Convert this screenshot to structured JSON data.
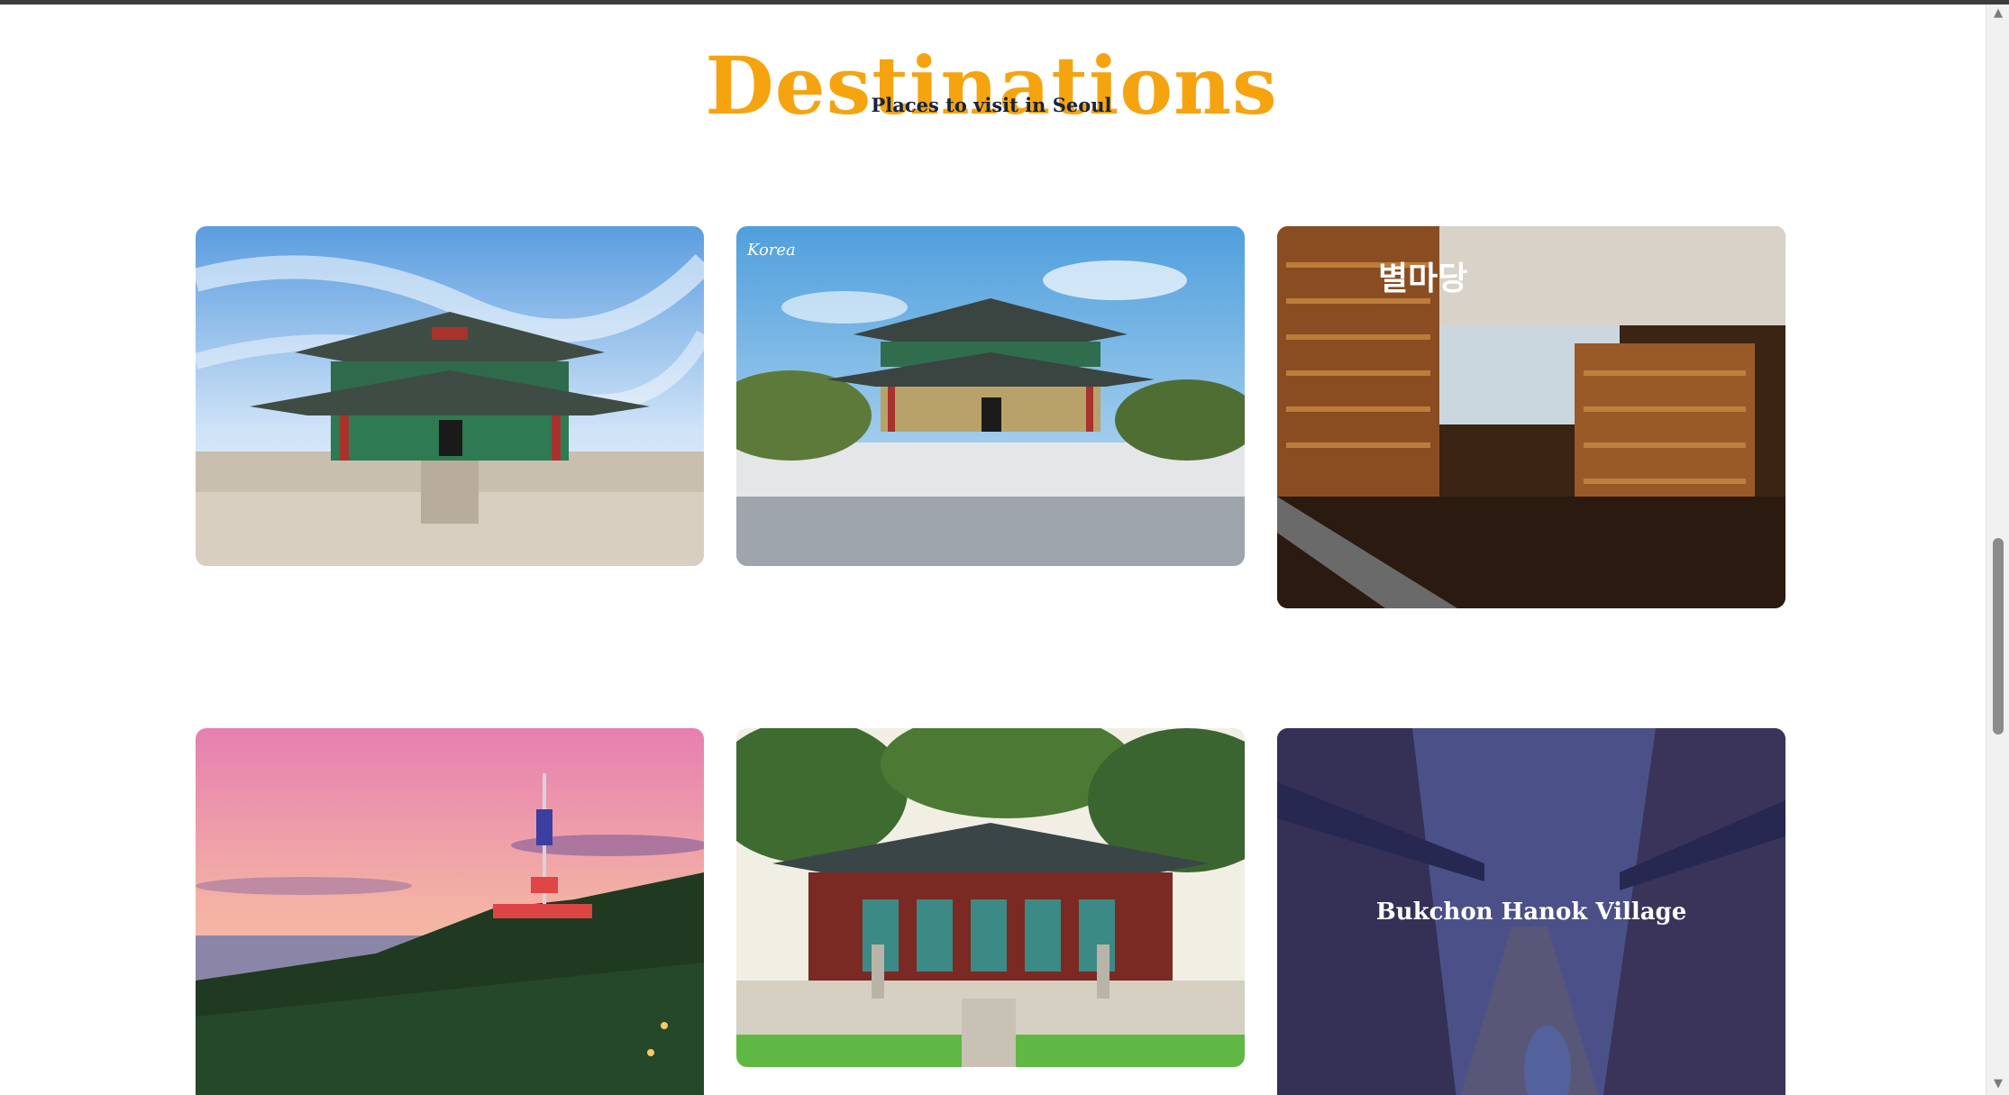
{
  "header": {
    "title": "Destinations",
    "subtitle": "Places to visit in Seoul"
  },
  "cards": [
    {
      "caption": "",
      "image": "palace-hall-photo"
    },
    {
      "caption": "",
      "image": "palace-courtyard-photo",
      "watermark": "Korea"
    },
    {
      "caption": "",
      "image": "library-photo",
      "sign": "별마당"
    },
    {
      "caption": "",
      "image": "tower-sunset-photo"
    },
    {
      "caption": "",
      "image": "temple-photo"
    },
    {
      "caption": "Bukchon Hanok Village",
      "image": "hanok-village-photo"
    }
  ],
  "scrollbar": {
    "up_icon": "triangle-up-icon",
    "down_icon": "triangle-down-icon"
  },
  "colors": {
    "accent": "#f5a410",
    "subtitle": "#16233f",
    "overlay": "#23266e"
  }
}
